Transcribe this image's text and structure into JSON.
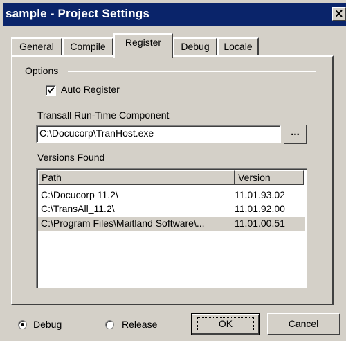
{
  "window": {
    "title": "sample - Project Settings"
  },
  "tabs": [
    {
      "label": "General"
    },
    {
      "label": "Compile"
    },
    {
      "label": "Register"
    },
    {
      "label": "Debug"
    },
    {
      "label": "Locale"
    }
  ],
  "options": {
    "group_label": "Options",
    "auto_register_label": "Auto Register",
    "auto_register_checked": true
  },
  "runtime": {
    "label": "Transall Run-Time Component",
    "value": "C:\\Docucorp\\TranHost.exe",
    "browse_label": "..."
  },
  "versions": {
    "label": "Versions Found",
    "columns": [
      "Path",
      "Version"
    ],
    "rows": [
      {
        "path": "C:\\Docucorp 11.2\\",
        "version": "11.01.93.02",
        "selected": false
      },
      {
        "path": "C:\\TransAll_11.2\\",
        "version": "11.01.92.00",
        "selected": false
      },
      {
        "path": "C:\\Program Files\\Maitland Software\\...",
        "version": "11.01.00.51",
        "selected": true
      }
    ]
  },
  "footer": {
    "debug_label": "Debug",
    "release_label": "Release",
    "selected_mode": "Debug",
    "ok_label": "OK",
    "cancel_label": "Cancel"
  }
}
